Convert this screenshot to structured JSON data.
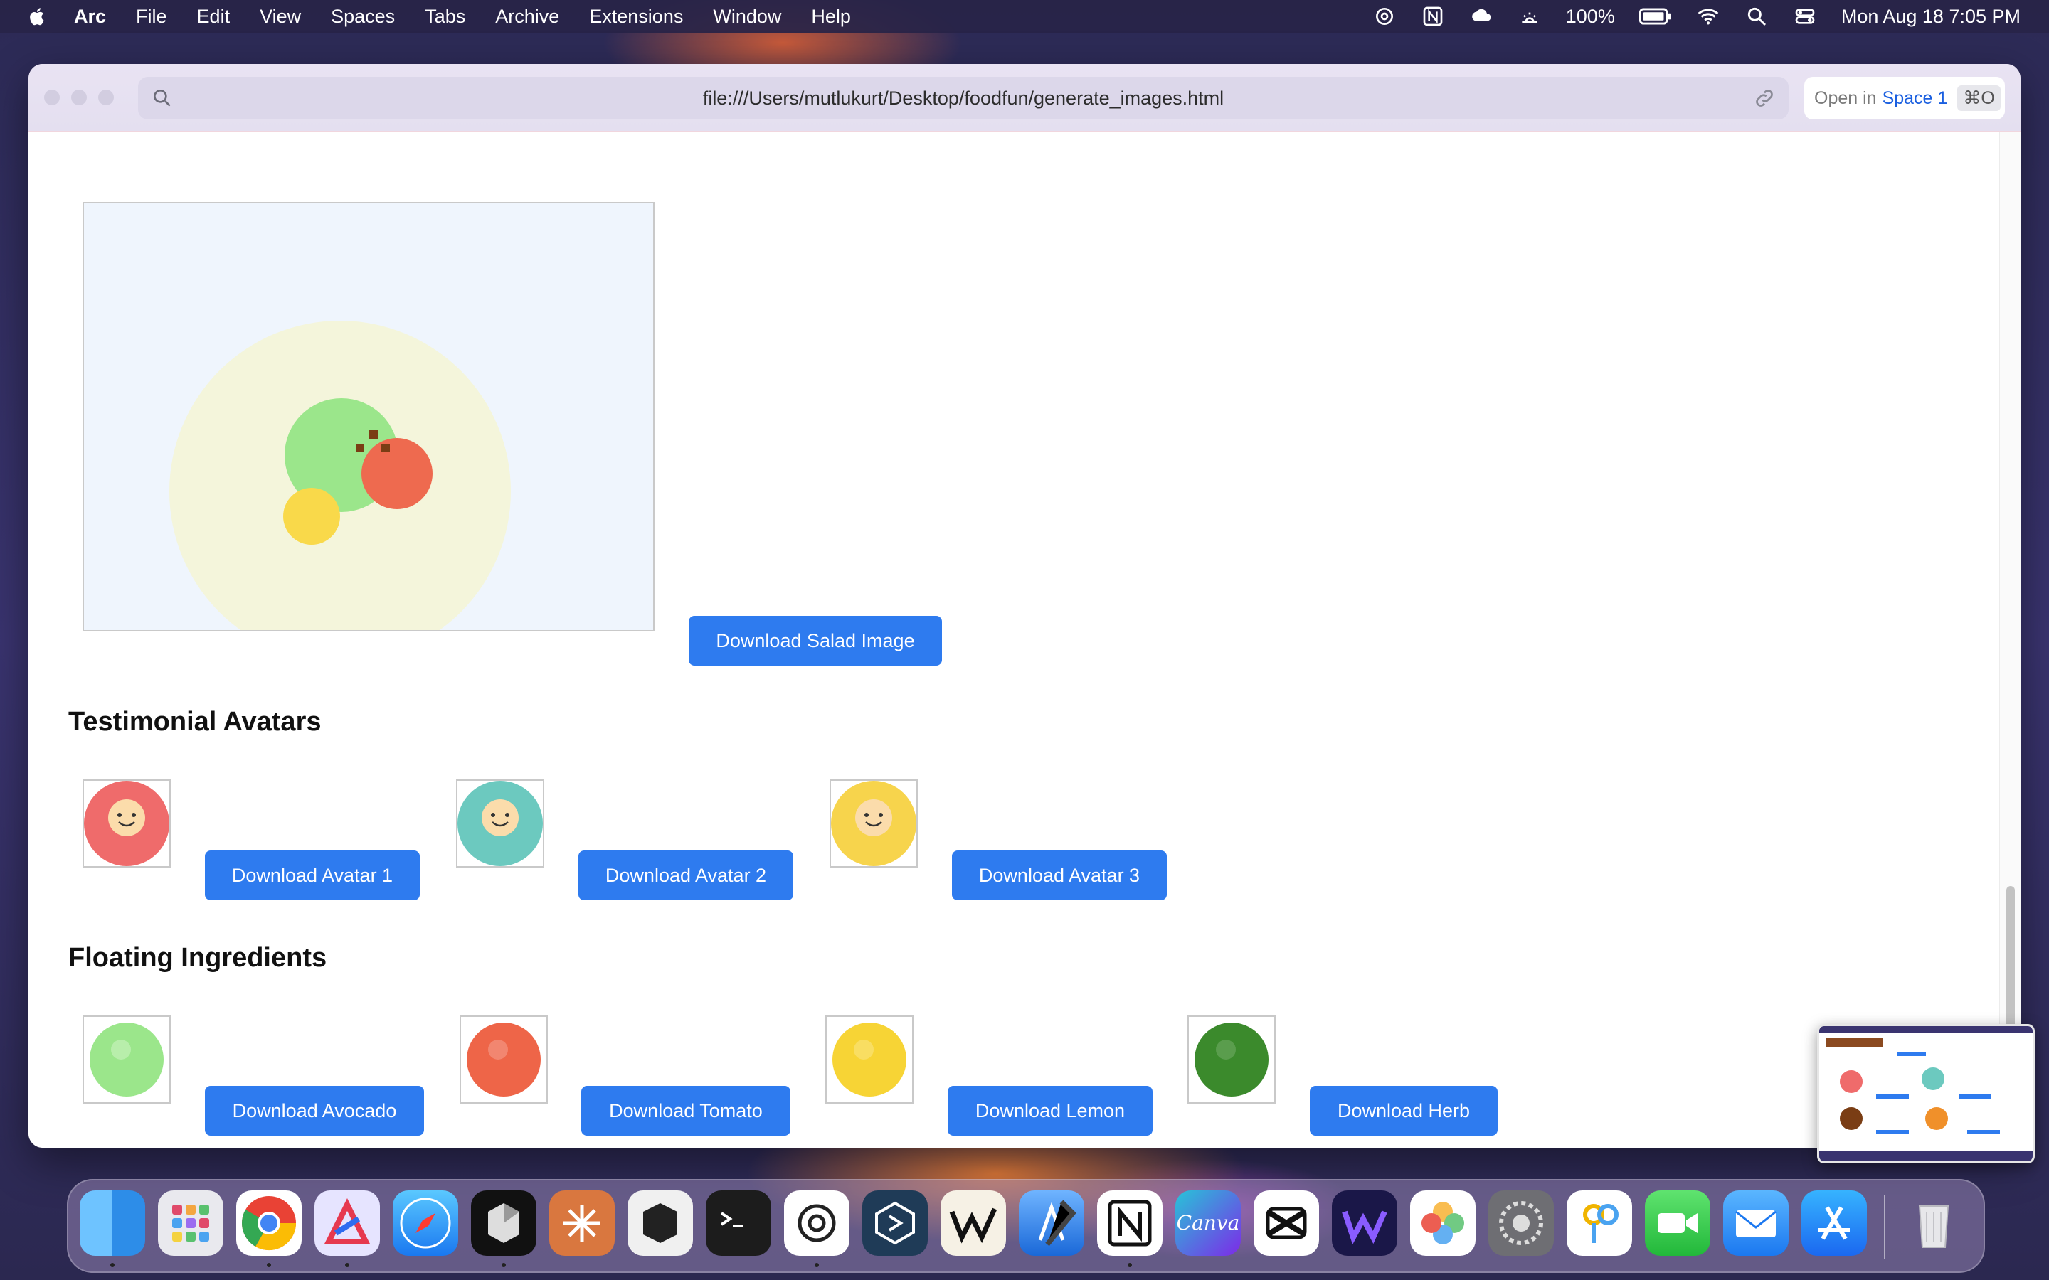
{
  "menubar": {
    "app_name": "Arc",
    "menus": [
      "File",
      "Edit",
      "View",
      "Spaces",
      "Tabs",
      "Archive",
      "Extensions",
      "Window",
      "Help"
    ],
    "battery": "100%",
    "clock": "Mon Aug 18  7:05 PM"
  },
  "browser": {
    "url": "file:///Users/mutlukurt/Desktop/foodfun/generate_images.html",
    "open_in_prefix": "Open in",
    "open_in_space": "Space 1",
    "open_in_shortcut": "⌘O"
  },
  "page": {
    "salad_button": "Download Salad Image",
    "avatars_title": "Testimonial Avatars",
    "avatars": [
      {
        "label": "Download Avatar 1",
        "color": "#ef6b6b"
      },
      {
        "label": "Download Avatar 2",
        "color": "#6cc9bf"
      },
      {
        "label": "Download Avatar 3",
        "color": "#f7d44c"
      }
    ],
    "ingredients_title": "Floating Ingredients",
    "ingredients": [
      {
        "label": "Download Avocado",
        "color": "#9be68b"
      },
      {
        "label": "Download Tomato",
        "color": "#ee6548"
      },
      {
        "label": "Download Lemon",
        "color": "#f7d435"
      },
      {
        "label": "Download Herb",
        "color": "#3b8a2c"
      }
    ]
  },
  "dock": {
    "apps": [
      "finder-icon",
      "launchpad-icon",
      "chrome-icon",
      "affinity-icon",
      "safari-icon",
      "cursor-icon",
      "claude-icon",
      "blackbox-icon",
      "terminal-icon",
      "chatgpt-icon",
      "linear-icon",
      "warp-icon",
      "xcode-icon",
      "notion-icon",
      "canva-icon",
      "capcut-icon",
      "webstorm-icon",
      "photos-icon",
      "settings-icon",
      "keychain-icon",
      "facetime-icon",
      "mail-icon",
      "appstore-icon",
      "trash-icon"
    ],
    "canva_text": "Canva"
  }
}
